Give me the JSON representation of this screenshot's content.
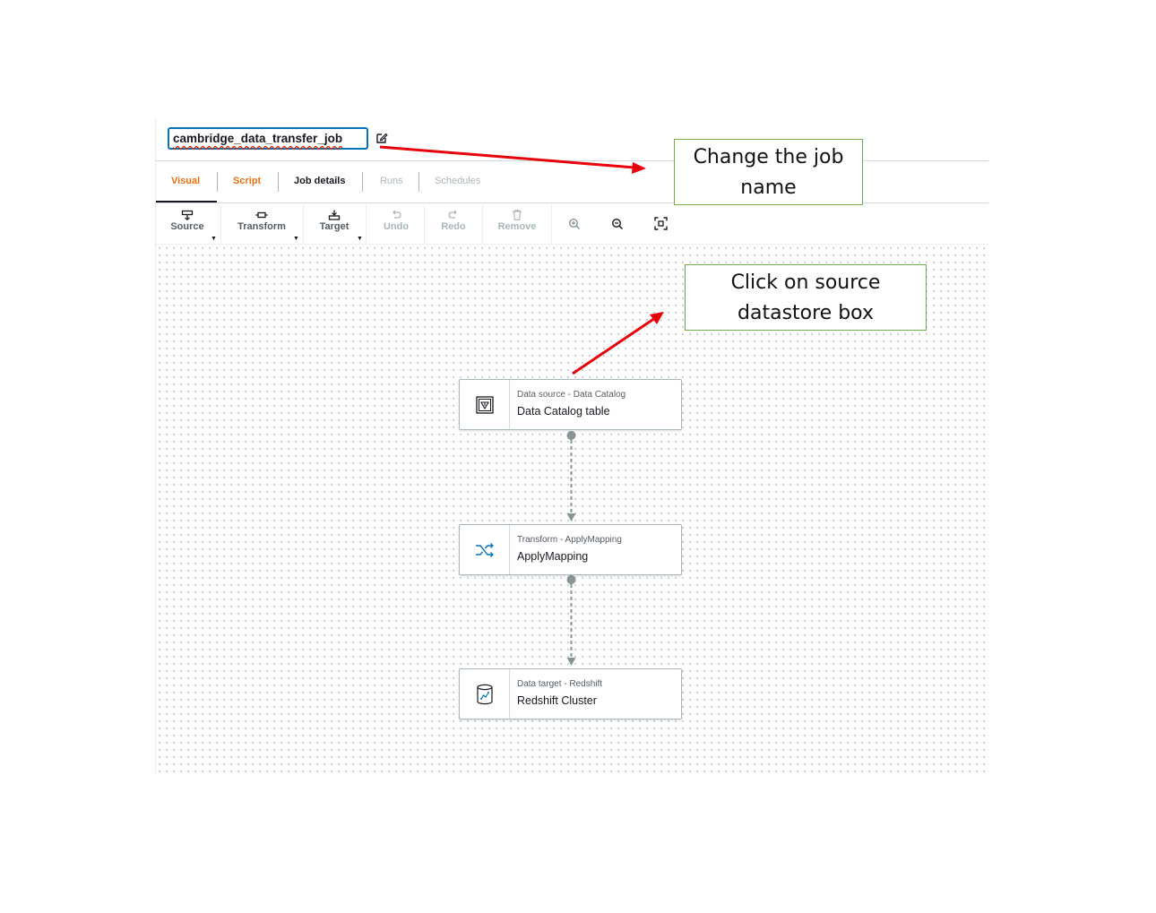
{
  "job": {
    "name": "cambridge_data_transfer_job"
  },
  "tabs": {
    "visual": "Visual",
    "script": "Script",
    "job_details": "Job details",
    "runs": "Runs",
    "schedules": "Schedules"
  },
  "toolbar": {
    "source": "Source",
    "transform": "Transform",
    "target": "Target",
    "undo": "Undo",
    "redo": "Redo",
    "remove": "Remove"
  },
  "nodes": [
    {
      "subtitle": "Data source - Data Catalog",
      "title": "Data Catalog table",
      "icon": "catalog-table-icon"
    },
    {
      "subtitle": "Transform - ApplyMapping",
      "title": "ApplyMapping",
      "icon": "shuffle-icon"
    },
    {
      "subtitle": "Data target - Redshift",
      "title": "Redshift Cluster",
      "icon": "redshift-cluster-icon"
    }
  ],
  "callouts": {
    "job_name_line1": "Change the job",
    "job_name_line2": "name",
    "source_line1": "Click on source",
    "source_line2": "datastore box"
  },
  "colors": {
    "accent": "#ec7211",
    "focus": "#0073bb",
    "arrow": "#e8000b",
    "callout_border": "#70ad47"
  }
}
